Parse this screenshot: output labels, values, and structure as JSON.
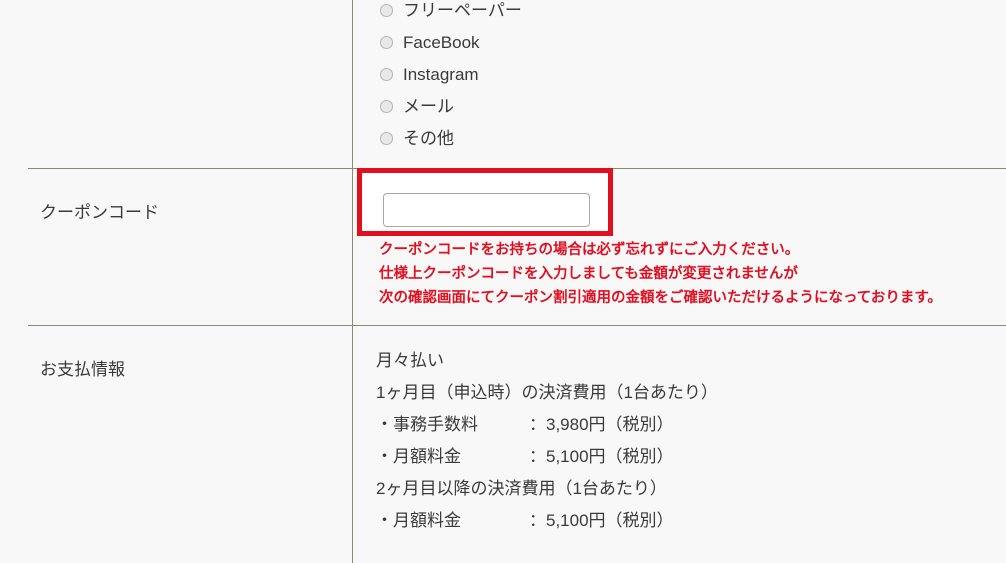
{
  "colors": {
    "background": "#f8f8f8",
    "divider": "#8a8a70",
    "text": "#3a3a3a",
    "alert_red": "#e01020",
    "input_border": "#a8a8a8"
  },
  "source_row": {
    "options": [
      {
        "label": "フリーペーパー",
        "selected": false
      },
      {
        "label": "FaceBook",
        "selected": false
      },
      {
        "label": "Instagram",
        "selected": false
      },
      {
        "label": "メール",
        "selected": false
      },
      {
        "label": "その他",
        "selected": false
      }
    ]
  },
  "coupon_row": {
    "label": "クーポンコード",
    "input_value": "",
    "input_placeholder": "",
    "notes": [
      "クーポンコードをお持ちの場合は必ず忘れずにご入力ください。",
      "仕様上クーポンコードを入力しましても金額が変更されませんが",
      "次の確認画面にてクーポン割引適用の金額をご確認いただけるようになっております。"
    ]
  },
  "payment_row": {
    "label": "お支払情報",
    "lines": [
      "月々払い",
      "1ヶ月目（申込時）の決済費用（1台あたり）",
      "・事務手数料　　　：3,980円（税別）",
      "・月額料金　　　　：5,100円（税別）",
      "2ヶ月目以降の決済費用（1台あたり）",
      "・月額料金　　　　：5,100円（税別）"
    ]
  }
}
